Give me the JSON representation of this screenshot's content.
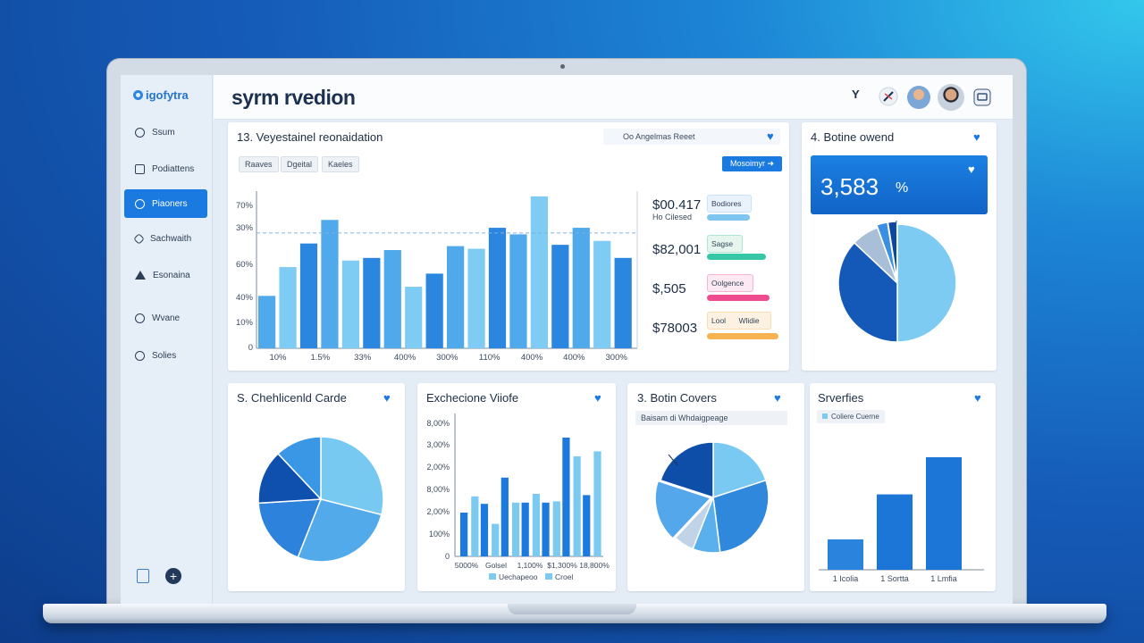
{
  "app": {
    "logo_text": "igofytra",
    "brand": "syrm rvedion"
  },
  "sidebar": {
    "items": [
      {
        "label": "Ssum",
        "icon": "circle-icon"
      },
      {
        "label": "Podiattens",
        "icon": "document-icon"
      },
      {
        "label": "Piaoners",
        "icon": "target-icon",
        "active": true
      },
      {
        "label": "Sachwaith",
        "icon": "gear-icon"
      },
      {
        "label": "Esonaina",
        "icon": "filter-icon"
      },
      {
        "label": "Wvane",
        "icon": "share-icon"
      },
      {
        "label": "Solies",
        "icon": "search-icon"
      }
    ]
  },
  "topbar": {
    "filter_label": "Y"
  },
  "card1": {
    "title": "13. Veyestainel reonaidation",
    "subtitle": "Oo Angelmas Reeet",
    "filters": [
      "Raaves",
      "Dgeital",
      "Kaeles"
    ],
    "action_label": "Mosoimyr",
    "chart_data": {
      "type": "bar",
      "y_ticks": [
        "70%",
        "30%",
        "60%",
        "40%",
        "10%",
        "0"
      ],
      "x_ticks": [
        "10%",
        "1.5%",
        "33%",
        "400%",
        "300%",
        "110%",
        "400%",
        "400%",
        "300%"
      ],
      "values": [
        40,
        62,
        80,
        98,
        67,
        69,
        75,
        47,
        57,
        78,
        76,
        92,
        87,
        116,
        79,
        92,
        82,
        69
      ],
      "ymax": 120,
      "reference": 88
    },
    "stats": [
      {
        "value": "$00.417",
        "sub": "Ho Cilesed",
        "pill": "Bodiores",
        "pill_color": "#eaf2fd",
        "bar_color": "#7ec5f0",
        "bar_fill": 0.85
      },
      {
        "value": "$82,001",
        "sub": "",
        "pill": "Sagse",
        "pill_color": "#e6f6ef",
        "bar_color": "#35c7a6",
        "bar_fill": 1.0
      },
      {
        "value": "$,505",
        "sub": "",
        "pill": "Oolgence",
        "pill_color": "#fde9f2",
        "bar_color": "#ee4c8f",
        "bar_fill": 1.0
      },
      {
        "value": "$78003",
        "sub": "",
        "pill": "Lool",
        "pill_extra": "Wlidie",
        "pill_color": "#fdf1e2",
        "bar_color": "#f6b351",
        "bar_fill": 1.0
      }
    ]
  },
  "card2": {
    "title": "4. Botine owend",
    "kpi": "3,583",
    "kpi_unit": "%",
    "chart_data": {
      "type": "pie",
      "slices": [
        {
          "value": 50,
          "color": "#7dcaf3"
        },
        {
          "value": 37,
          "color": "#1458b8"
        },
        {
          "value": 7.5,
          "color": "#a9bfd8"
        },
        {
          "value": 3,
          "color": "#3b8fe0"
        },
        {
          "value": 2.5,
          "color": "#0e47a0"
        }
      ]
    }
  },
  "card3": {
    "title": "S. Chehlicenld Carde",
    "chart_data": {
      "type": "pie",
      "slices": [
        {
          "value": 29,
          "color": "#78c9f2"
        },
        {
          "value": 27,
          "color": "#52aaeb"
        },
        {
          "value": 18,
          "color": "#2d83dc"
        },
        {
          "value": 14,
          "color": "#0f4fae"
        },
        {
          "value": 12,
          "color": "#3a97e6"
        }
      ]
    }
  },
  "card4": {
    "title": "Exchecione Viiofe",
    "legend": [
      "Uechapeoo",
      "Croel"
    ],
    "chart_data": {
      "type": "bar",
      "y_ticks": [
        "8,00%",
        "3,00%",
        "2,00%",
        "8,00%",
        "2,00%",
        "100%",
        "0"
      ],
      "x_ticks": [
        "5000%",
        "Golsel",
        "1,100%",
        "$1,300%",
        "18,800%"
      ],
      "series": [
        {
          "name": "Uechapeoo",
          "values": [
            35,
            42,
            63,
            43,
            43,
            95,
            49
          ],
          "color": "#1c7adf"
        },
        {
          "name": "Croel",
          "values": [
            48,
            26,
            43,
            50,
            44,
            80,
            84
          ],
          "color": "#7ccaf0"
        }
      ],
      "ymax": 100
    }
  },
  "card5": {
    "title": "3. Botin Covers",
    "filter_text": "Baisam di Whdaigpeage",
    "chart_data": {
      "type": "pie",
      "slices": [
        {
          "value": 20,
          "color": "#79c9f2"
        },
        {
          "value": 28,
          "color": "#2f88dc"
        },
        {
          "value": 8,
          "color": "#5ab0ec"
        },
        {
          "value": 6,
          "color": "#c1d3e6"
        },
        {
          "value": 18,
          "color": "#54a7ea"
        },
        {
          "value": 20,
          "color": "#0e4ea8"
        }
      ]
    }
  },
  "card6": {
    "title": "Srverfies",
    "legend": "Coliere Cuerne",
    "chart_data": {
      "type": "bar",
      "categories": [
        "1 Icolia",
        "1 Sortta",
        "1 Lmfia"
      ],
      "values": [
        27,
        67,
        100
      ],
      "ymax": 100
    }
  }
}
